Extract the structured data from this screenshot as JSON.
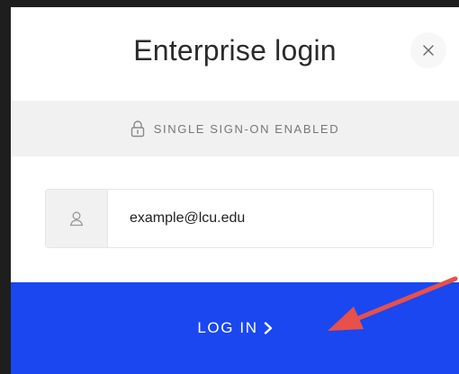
{
  "modal": {
    "title": "Enterprise login",
    "close_icon": "close-icon"
  },
  "sso": {
    "icon": "lock-icon",
    "text": "SINGLE SIGN-ON ENABLED"
  },
  "email": {
    "icon": "user-icon",
    "value": "example@lcu.edu"
  },
  "login_button": {
    "label": "LOG IN",
    "icon": "chevron-right-icon"
  },
  "annotation": {
    "icon": "arrow-annotation-icon",
    "color": "#e8504a"
  },
  "colors": {
    "accent": "#1a47f0",
    "background": "#1e1e1e"
  }
}
